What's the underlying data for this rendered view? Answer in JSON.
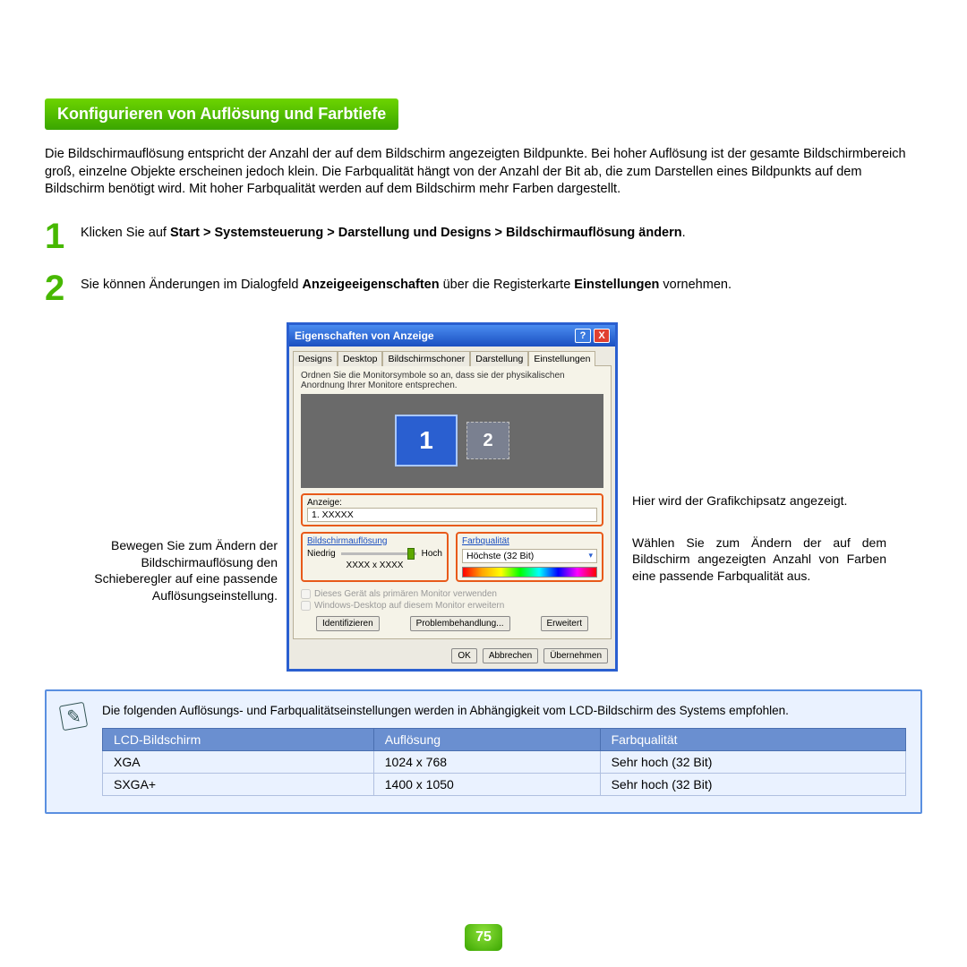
{
  "heading": "Konfigurieren von Auflösung und Farbtiefe",
  "intro": "Die Bildschirmauflösung entspricht der Anzahl der auf dem Bildschirm angezeigten Bildpunkte. Bei hoher Auflösung ist der gesamte Bildschirmbereich groß, einzelne Objekte erscheinen jedoch klein. Die Farbqualität hängt von der Anzahl der Bit ab, die zum Darstellen eines Bildpunkts auf dem Bildschirm benötigt wird. Mit hoher Farbqualität werden auf dem Bildschirm mehr Farben dargestellt.",
  "steps": {
    "s1": {
      "num": "1",
      "pre": "Klicken Sie auf ",
      "bold": "Start > Systemsteuerung > Darstellung und Designs > Bildschirmauflösung ändern",
      "post": "."
    },
    "s2": {
      "num": "2",
      "pre": "Sie können Änderungen im Dialogfeld ",
      "bold1": "Anzeigeeigenschaften",
      "mid": " über die Registerkarte ",
      "bold2": "Einstellungen",
      "post": " vornehmen."
    }
  },
  "callouts": {
    "left": "Bewegen Sie zum Ändern der Bildschirmauflösung den Schieberegler auf eine passende Auflösungseinstellung.",
    "right1": "Hier wird der Grafikchipsatz angezeigt.",
    "right2": "Wählen Sie zum Ändern der auf dem Bildschirm angezeigten Anzahl von Farben eine passende Farbqualität aus."
  },
  "dialog": {
    "title": "Eigenschaften von Anzeige",
    "help": "?",
    "close": "X",
    "tabs": [
      "Designs",
      "Desktop",
      "Bildschirmschoner",
      "Darstellung",
      "Einstellungen"
    ],
    "hint": "Ordnen Sie die Monitorsymbole so an, dass sie der physikalischen Anordnung Ihrer Monitore entsprechen.",
    "mon1": "1",
    "mon2": "2",
    "anzeige_label": "Anzeige:",
    "anzeige_value": "1. XXXXX",
    "res_label": "Bildschirmauflösung",
    "res_low": "Niedrig",
    "res_high": "Hoch",
    "res_value": "XXXX  x  XXXX",
    "color_label": "Farbqualität",
    "color_value": "Höchste (32 Bit)",
    "chk1": "Dieses Gerät als primären Monitor verwenden",
    "chk2": "Windows-Desktop auf diesem Monitor erweitern",
    "btn_identify": "Identifizieren",
    "btn_trouble": "Problembehandlung...",
    "btn_adv": "Erweitert",
    "btn_ok": "OK",
    "btn_cancel": "Abbrechen",
    "btn_apply": "Übernehmen"
  },
  "note": {
    "text": "Die folgenden Auflösungs- und Farbqualitätseinstellungen werden in Abhängigkeit vom LCD-Bildschirm des Systems empfohlen.",
    "headers": [
      "LCD-Bildschirm",
      "Auflösung",
      "Farbqualität"
    ],
    "rows": [
      [
        "XGA",
        "1024 x 768",
        "Sehr hoch (32 Bit)"
      ],
      [
        "SXGA+",
        "1400 x 1050",
        "Sehr hoch (32 Bit)"
      ]
    ]
  },
  "page": "75"
}
